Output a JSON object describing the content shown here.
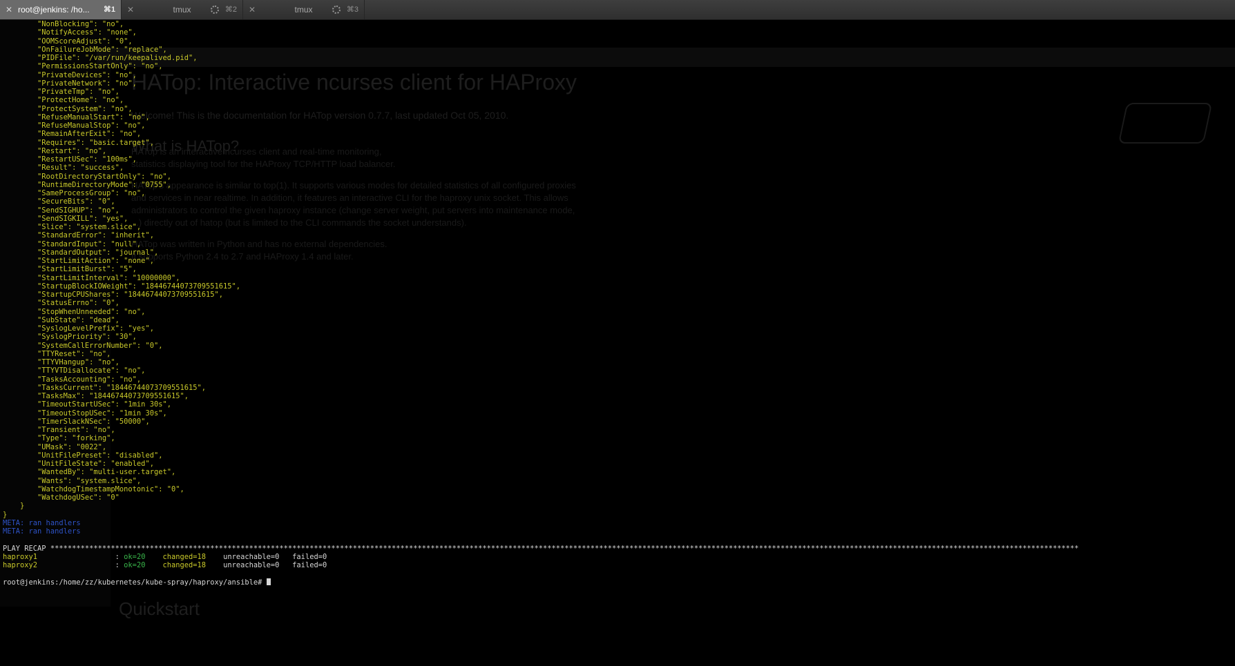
{
  "tabs": [
    {
      "title": "root@jenkins: /ho...",
      "shortcut": "⌘1",
      "active": true
    },
    {
      "title": "tmux",
      "shortcut": "⌘2",
      "active": false
    },
    {
      "title": "tmux",
      "shortcut": "⌘3",
      "active": false
    }
  ],
  "background_page": {
    "heading": "HATop: Interactive ncurses client for HAProxy",
    "intro": "Welcome! This is the documentation for HATop version 0.7.7, last updated Oct 05, 2010.",
    "what_is_heading": "What is HATop?",
    "para_lines": [
      "HATop is an interactive ncurses client and real-time monitoring,",
      "statistics displaying tool for the HAProxy TCP/HTTP load balancer.",
      "HATop's appearance is similar to top(1). It supports various modes for detailed statistics of all configured proxies",
      "and services in near realtime. In addition, it features an interactive CLI for the haproxy unix socket. This allows",
      "administrators to control the given haproxy instance (change server weight, put servers into maintenance mode,",
      "...) directly out of hatop (but is limited to the CLI commands the socket understands).",
      "HATop was written in Python and has no external dependencies.",
      "It supports Python 2.4 to 2.7 and HAProxy 1.4 and later."
    ],
    "quickstart": "Quickstart"
  },
  "terminal": {
    "properties": [
      [
        "NonBlocking",
        "no"
      ],
      [
        "NotifyAccess",
        "none"
      ],
      [
        "OOMScoreAdjust",
        "0"
      ],
      [
        "OnFailureJobMode",
        "replace"
      ],
      [
        "PIDFile",
        "/var/run/keepalived.pid"
      ],
      [
        "PermissionsStartOnly",
        "no"
      ],
      [
        "PrivateDevices",
        "no"
      ],
      [
        "PrivateNetwork",
        "no"
      ],
      [
        "PrivateTmp",
        "no"
      ],
      [
        "ProtectHome",
        "no"
      ],
      [
        "ProtectSystem",
        "no"
      ],
      [
        "RefuseManualStart",
        "no"
      ],
      [
        "RefuseManualStop",
        "no"
      ],
      [
        "RemainAfterExit",
        "no"
      ],
      [
        "Requires",
        "basic.target"
      ],
      [
        "Restart",
        "no"
      ],
      [
        "RestartUSec",
        "100ms"
      ],
      [
        "Result",
        "success"
      ],
      [
        "RootDirectoryStartOnly",
        "no"
      ],
      [
        "RuntimeDirectoryMode",
        "0755"
      ],
      [
        "SameProcessGroup",
        "no"
      ],
      [
        "SecureBits",
        "0"
      ],
      [
        "SendSIGHUP",
        "no"
      ],
      [
        "SendSIGKILL",
        "yes"
      ],
      [
        "Slice",
        "system.slice"
      ],
      [
        "StandardError",
        "inherit"
      ],
      [
        "StandardInput",
        "null"
      ],
      [
        "StandardOutput",
        "journal"
      ],
      [
        "StartLimitAction",
        "none"
      ],
      [
        "StartLimitBurst",
        "5"
      ],
      [
        "StartLimitInterval",
        "10000000"
      ],
      [
        "StartupBlockIOWeight",
        "18446744073709551615"
      ],
      [
        "StartupCPUShares",
        "18446744073709551615"
      ],
      [
        "StatusErrno",
        "0"
      ],
      [
        "StopWhenUnneeded",
        "no"
      ],
      [
        "SubState",
        "dead"
      ],
      [
        "SyslogLevelPrefix",
        "yes"
      ],
      [
        "SyslogPriority",
        "30"
      ],
      [
        "SystemCallErrorNumber",
        "0"
      ],
      [
        "TTYReset",
        "no"
      ],
      [
        "TTYVHangup",
        "no"
      ],
      [
        "TTYVTDisallocate",
        "no"
      ],
      [
        "TasksAccounting",
        "no"
      ],
      [
        "TasksCurrent",
        "18446744073709551615"
      ],
      [
        "TasksMax",
        "18446744073709551615"
      ],
      [
        "TimeoutStartUSec",
        "1min 30s"
      ],
      [
        "TimeoutStopUSec",
        "1min 30s"
      ],
      [
        "TimerSlackNSec",
        "50000"
      ],
      [
        "Transient",
        "no"
      ],
      [
        "Type",
        "forking"
      ],
      [
        "UMask",
        "0022"
      ],
      [
        "UnitFilePreset",
        "disabled"
      ],
      [
        "UnitFileState",
        "enabled"
      ],
      [
        "WantedBy",
        "multi-user.target"
      ],
      [
        "Wants",
        "system.slice"
      ],
      [
        "WatchdogTimestampMonotonic",
        "0"
      ],
      [
        "WatchdogUSec",
        "0"
      ]
    ],
    "inner_close": "    }",
    "outer_close": "}",
    "meta_lines": [
      "META: ran handlers",
      "META: ran handlers"
    ],
    "recap_title": "PLAY RECAP",
    "recap_rows": [
      {
        "host": "haproxy1",
        "ok": "ok=20",
        "changed": "changed=18",
        "unreachable": "unreachable=0",
        "failed": "failed=0"
      },
      {
        "host": "haproxy2",
        "ok": "ok=20",
        "changed": "changed=18",
        "unreachable": "unreachable=0",
        "failed": "failed=0"
      }
    ],
    "prompt": "root@jenkins:/home/zz/kubernetes/kube-spray/haproxy/ansible# "
  },
  "colors": {
    "yellow": "#c9c92a",
    "blue": "#2e53c7",
    "green": "#39b64a",
    "white": "#d6d6d6"
  }
}
